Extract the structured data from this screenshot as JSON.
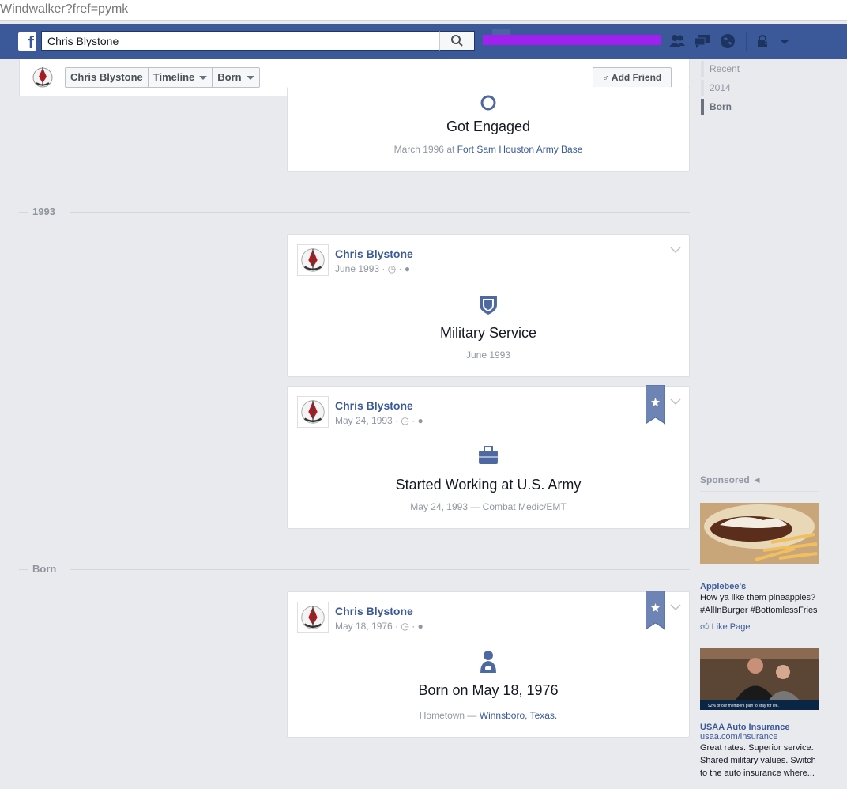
{
  "browser": {
    "url": "Windwalker?fref=pymk"
  },
  "topbar": {
    "search_value": "Chris Blystone"
  },
  "sticky": {
    "crumbs": [
      "Chris Blystone",
      "Timeline",
      "Born"
    ],
    "add_friend": "Add Friend"
  },
  "scrubber": {
    "items": [
      "Recent",
      "2014",
      "Born"
    ],
    "active": "Born"
  },
  "sections": {
    "y1993": "1993",
    "born": "Born"
  },
  "cards": [
    {
      "title": "Got Engaged",
      "sub_prefix": "March 1996 at ",
      "sub_link": "Fort Sam Houston Army Base"
    },
    {
      "author": "Chris Blystone",
      "date": "June 1993 ·",
      "icon": "shield-icon",
      "title": "Military Service",
      "sub": "June 1993"
    },
    {
      "author": "Chris Blystone",
      "date": "May 24, 1993 ·",
      "icon": "briefcase-icon",
      "title": "Started Working at U.S. Army",
      "sub": "May 24, 1993 — Combat Medic/EMT"
    },
    {
      "author": "Chris Blystone",
      "date": "May 18, 1976 ·",
      "icon": "baby-icon",
      "title": "Born on May 18, 1976",
      "sub_prefix": "Hometown — ",
      "sub_link": "Winnsboro, Texas."
    }
  ],
  "sponsored": {
    "label": "Sponsored",
    "ads": [
      {
        "title": "Applebee's",
        "text1": "How ya like them pineapples?",
        "text2": "#AllInBurger #BottomlessFries",
        "like": "Like Page"
      },
      {
        "title": "USAA Auto Insurance",
        "url": "usaa.com/insurance",
        "text1": "Great rates. Superior service.",
        "text2": "Shared military values. Switch",
        "text3": "to the auto insurance where...",
        "banner": "92% of our members plan to stay for life."
      }
    ]
  },
  "colors": {
    "facebook_blue": "#3b5998",
    "background": "#e9eaed",
    "redacted": "#a020f0"
  }
}
